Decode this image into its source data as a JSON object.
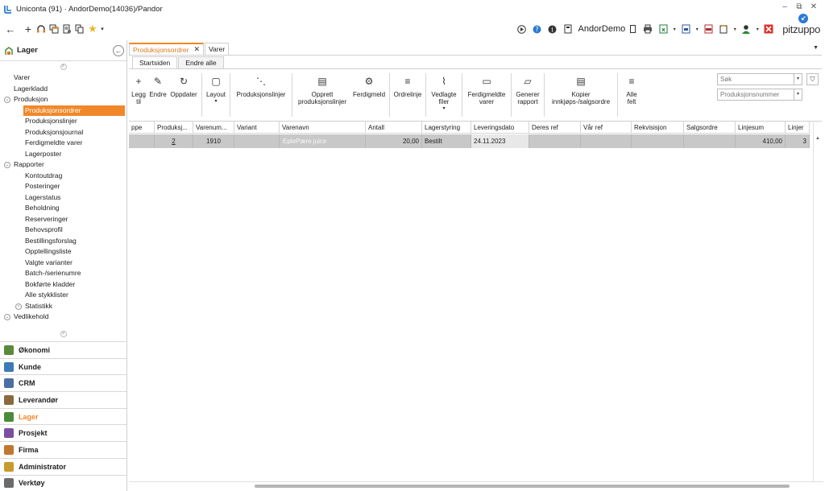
{
  "window": {
    "title": "Uniconta (91)  · AndorDemo(14036)/Pandor",
    "controls": [
      "–",
      "⧉",
      "✕"
    ]
  },
  "header": {
    "user_name": "AndorDemo",
    "logo_text": "pitzuppo"
  },
  "left_panel": {
    "title": "Lager",
    "tree": [
      {
        "label": "Varer",
        "level": 0
      },
      {
        "label": "Lagerkladd",
        "level": 0
      },
      {
        "label": "Produksjon",
        "level": 0,
        "expander": "⌄"
      },
      {
        "label": "Produksjonsordrer",
        "level": 1,
        "selected": true
      },
      {
        "label": "Produksjonslinjer",
        "level": 1
      },
      {
        "label": "Produksjonsjournal",
        "level": 1
      },
      {
        "label": "Ferdigmeldte varer",
        "level": 1
      },
      {
        "label": "Lagerposter",
        "level": 1
      },
      {
        "label": "Rapporter",
        "level": 0,
        "expander": "⌄"
      },
      {
        "label": "Kontoutdrag",
        "level": 1
      },
      {
        "label": "Posteringer",
        "level": 1
      },
      {
        "label": "Lagerstatus",
        "level": 1
      },
      {
        "label": "Beholdning",
        "level": 1
      },
      {
        "label": "Reserveringer",
        "level": 1
      },
      {
        "label": "Behovsprofil",
        "level": 1
      },
      {
        "label": "Bestillingsforslag",
        "level": 1
      },
      {
        "label": "Opptellingsliste",
        "level": 1
      },
      {
        "label": "Valgte varianter",
        "level": 1
      },
      {
        "label": "Batch-/serienumre",
        "level": 1
      },
      {
        "label": "Bokførte kladder",
        "level": 1
      },
      {
        "label": "Alle stykklister",
        "level": 1
      },
      {
        "label": "Statistikk",
        "level": 1,
        "expander": "›"
      },
      {
        "label": "Vedlikehold",
        "level": 0,
        "expander": "⌄"
      }
    ],
    "modules": [
      {
        "label": "Økonomi",
        "color": "#5a8a3c"
      },
      {
        "label": "Kunde",
        "color": "#3d7ab8"
      },
      {
        "label": "CRM",
        "color": "#4a6fa5"
      },
      {
        "label": "Leverandør",
        "color": "#8b6a3e"
      },
      {
        "label": "Lager",
        "color": "#4b8a3a",
        "active": true
      },
      {
        "label": "Prosjekt",
        "color": "#7a4fa0"
      },
      {
        "label": "Firma",
        "color": "#c0782f"
      },
      {
        "label": "Administrator",
        "color": "#c99a2e"
      },
      {
        "label": "Verktøy",
        "color": "#6b6b6b"
      }
    ]
  },
  "doc_tabs": [
    {
      "label": "Produksjonsordrer",
      "active": true,
      "close": "✕"
    },
    {
      "label": "Varer",
      "active": false
    }
  ],
  "ribbon_tabs": [
    {
      "label": "Startsiden",
      "active": true
    },
    {
      "label": "Endre alle",
      "active": false
    }
  ],
  "ribbon": {
    "buttons": [
      {
        "label": "Legg til",
        "icon": "plus-icon",
        "glyph": "+"
      },
      {
        "label": "Endre",
        "icon": "pencil-icon",
        "glyph": "✎"
      },
      {
        "label": "Oppdater",
        "icon": "refresh-icon",
        "glyph": "↻"
      },
      {
        "label": "Layout",
        "icon": "layout-icon",
        "glyph": "▢",
        "dropdown": "▾"
      },
      {
        "label": "Produksjonslinjer",
        "icon": "hierarchy-icon",
        "glyph": "⋱"
      },
      {
        "label": "Opprett produksjonslinjer",
        "icon": "document-icon",
        "glyph": "▤"
      },
      {
        "label": "Ferdigmeld",
        "icon": "gears-icon",
        "glyph": "⚙"
      },
      {
        "label": "Ordrelinje",
        "icon": "list-icon",
        "glyph": "≡"
      },
      {
        "label": "Vedlagte filer",
        "icon": "paperclip-icon",
        "glyph": "⌇",
        "dropdown": "▾"
      },
      {
        "label": "Ferdigmeldte varer",
        "icon": "box-icon",
        "glyph": "▭"
      },
      {
        "label": "Generer rapport",
        "icon": "folder-icon",
        "glyph": "▱"
      },
      {
        "label": "Kopier innkjøps-/salgsordre",
        "icon": "copy-document-icon",
        "glyph": "▤"
      },
      {
        "label": "Alle felt",
        "icon": "menu-icon",
        "glyph": "≡"
      }
    ],
    "search_placeholder": "Søk",
    "search_field_placeholder": "Produksjonsnummer",
    "dropdown_glyph": "▾",
    "filter_glyph": "⛉"
  },
  "table": {
    "columns": [
      "ppe",
      "Produksj...",
      "Varenum...",
      "Variant",
      "Varenavn",
      "Antall",
      "Lagerstyring",
      "Leveringsdato",
      "Deres ref",
      "Vår ref",
      "Rekvisisjon",
      "Salgsordre",
      "Linjesum",
      "Linjer"
    ],
    "rows": [
      [
        "",
        "2",
        "1910",
        "",
        "EplePære juice",
        "20,00",
        "Bestilt",
        "24.11.2023",
        "",
        "",
        "",
        "",
        "410,00",
        "3"
      ]
    ]
  }
}
